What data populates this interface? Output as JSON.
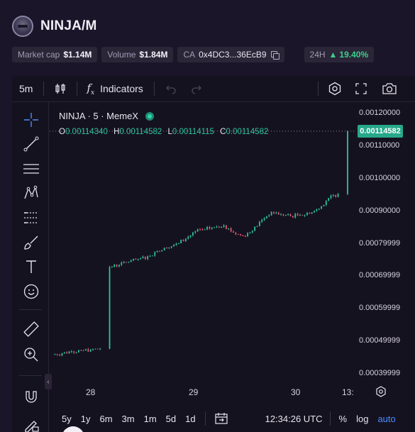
{
  "header": {
    "pair_title": "NINJA/M"
  },
  "stats": {
    "market_cap_label": "Market cap",
    "market_cap_value": "$1.14M",
    "volume_label": "Volume",
    "volume_value": "$1.84M",
    "ca_label": "CA",
    "ca_value": "0x4DC3...36EcB9",
    "change_label": "24H",
    "change_value": "19.40%"
  },
  "toolbar": {
    "interval": "5m",
    "indicators_label": "Indicators"
  },
  "legend": {
    "symbol": "NINJA · 5 · MemeX",
    "o_label": "O",
    "o_value": "0.00114340",
    "h_label": "H",
    "h_value": "0.00114582",
    "l_label": "L",
    "l_value": "0.00114115",
    "c_label": "C",
    "c_value": "0.00114582"
  },
  "yaxis": {
    "ticks": [
      "0.00120000",
      "0.00110000",
      "0.00100000",
      "0.00090000",
      "0.00079999",
      "0.00069999",
      "0.00059999",
      "0.00049999",
      "0.00039999"
    ],
    "current_price": "0.00114582"
  },
  "xaxis": {
    "ticks": [
      "28",
      "29",
      "30",
      "13:"
    ]
  },
  "bottom_bar": {
    "ranges": [
      "5y",
      "1y",
      "6m",
      "3m",
      "1m",
      "5d",
      "1d"
    ],
    "time": "12:34:26 UTC",
    "percent_label": "%",
    "log_label": "log",
    "auto_label": "auto"
  },
  "colors": {
    "up": "#2fc29a",
    "down": "#e0566f",
    "price_line": "#26a88a",
    "accent_blue": "#4c8dff"
  },
  "chart_data": {
    "type": "line",
    "title": "",
    "xlabel": "",
    "ylabel": "",
    "x": [
      "27 20:00",
      "28 00:00",
      "28 02:00",
      "28 04:00",
      "28 06:00",
      "28 07:30",
      "28 08:00",
      "28 09:00",
      "28 12:00",
      "28 16:00",
      "28 18:00",
      "28 20:00",
      "29 00:00",
      "29 02:00",
      "29 04:00",
      "29 06:00",
      "29 08:00",
      "29 10:00",
      "29 12:00",
      "29 14:00",
      "29 16:00",
      "29 18:00",
      "29 20:00",
      "29 22:00",
      "30 00:00",
      "30 02:00",
      "30 04:00",
      "30 06:00",
      "30 08:00",
      "30 10:00",
      "30 12:00",
      "30 12:30"
    ],
    "series": [
      {
        "values": [
          0.000459,
          0.000463,
          0.000469,
          0.000471,
          0.000474,
          0.000477,
          0.000728,
          0.000735,
          0.000744,
          0.000752,
          0.000761,
          0.000777,
          0.000786,
          0.0008,
          0.000815,
          0.000838,
          0.000844,
          0.000851,
          0.000856,
          0.000834,
          0.000823,
          0.00084,
          0.000873,
          0.000898,
          0.00089,
          0.000885,
          0.000888,
          0.000892,
          0.000908,
          0.00094,
          0.000953,
          0.001146
        ]
      }
    ],
    "ylim": [
      0.00039999,
      0.0012
    ],
    "grid": false
  }
}
